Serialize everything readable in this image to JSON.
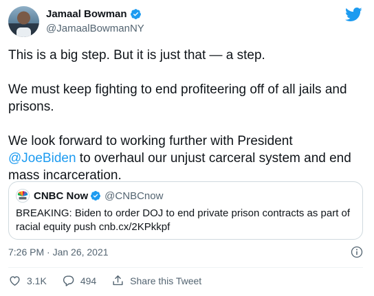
{
  "author": {
    "display_name": "Jamaal Bowman",
    "handle": "@JamaalBowmanNY",
    "avatar_icon": "avatar-photo",
    "verified_icon": "verified-badge-icon"
  },
  "brand_icon": "twitter-bird-icon",
  "tweet": {
    "paragraph_1": "This is a big step. But it is just that — a step.",
    "paragraph_2": "We must keep fighting to end profiteering off of all jails and prisons.",
    "paragraph_3_before": "We look forward to working further with President ",
    "mention": "@JoeBiden",
    "paragraph_3_after": " to overhaul our unjust carceral system and end mass incarceration."
  },
  "quoted_tweet": {
    "display_name": "CNBC Now",
    "handle": "@CNBCnow",
    "text": "BREAKING: Biden to order DOJ to end private prison contracts as part of racial equity push cnb.cx/2KPkkpf",
    "logo_icon": "cnbc-peacock-logo"
  },
  "timestamp": "7:26 PM · Jan 26, 2021",
  "actions": {
    "like_count": "3.1K",
    "reply_count": "494",
    "share_label": "Share this Tweet"
  },
  "colors": {
    "accent": "#1d9bf0",
    "text": "#0f1419",
    "secondary": "#536471",
    "border": "#cfd9de"
  }
}
